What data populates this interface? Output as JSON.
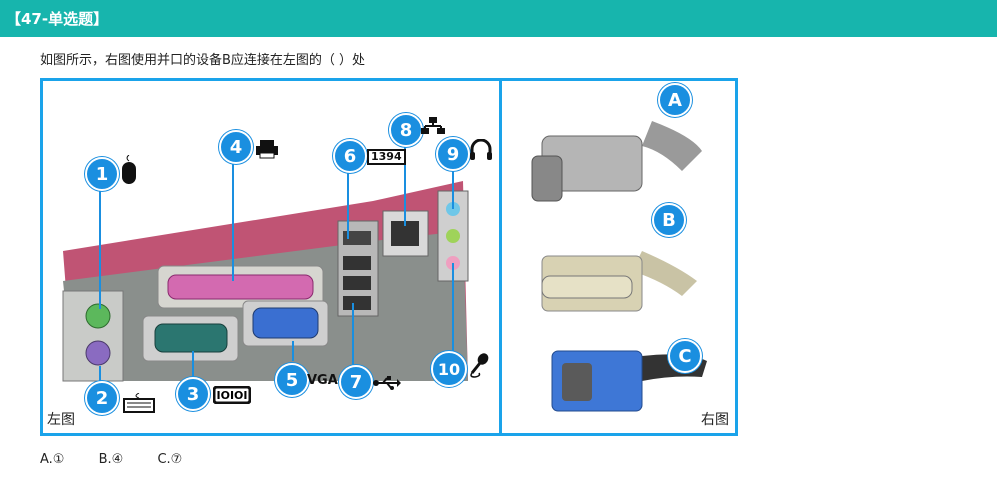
{
  "header": {
    "title": "【47-单选题】"
  },
  "question": {
    "text": "如图所示，右图使用并口的设备B应连接在左图的（    ）处"
  },
  "figure": {
    "left_caption": "左图",
    "right_caption": "右图",
    "port_numbers": [
      "1",
      "2",
      "3",
      "4",
      "5",
      "6",
      "7",
      "8",
      "9",
      "10"
    ],
    "vga_label": "VGA",
    "firewire_label": "1394",
    "connector_letters": [
      "A",
      "B",
      "C"
    ],
    "icons": {
      "1": "mouse-icon",
      "2": "keyboard-icon",
      "3": "serial-port-icon",
      "4": "printer-icon",
      "6": "firewire-icon",
      "7": "usb-icon",
      "8": "network-icon",
      "9": "headphones-icon",
      "10": "microphone-icon"
    }
  },
  "options": [
    {
      "label": "A.①"
    },
    {
      "label": "B.④"
    },
    {
      "label": "C.⑦"
    }
  ],
  "colors": {
    "header_bg": "#17b5ad",
    "frame": "#1aa3ea",
    "badge": "#1a8fe0"
  }
}
